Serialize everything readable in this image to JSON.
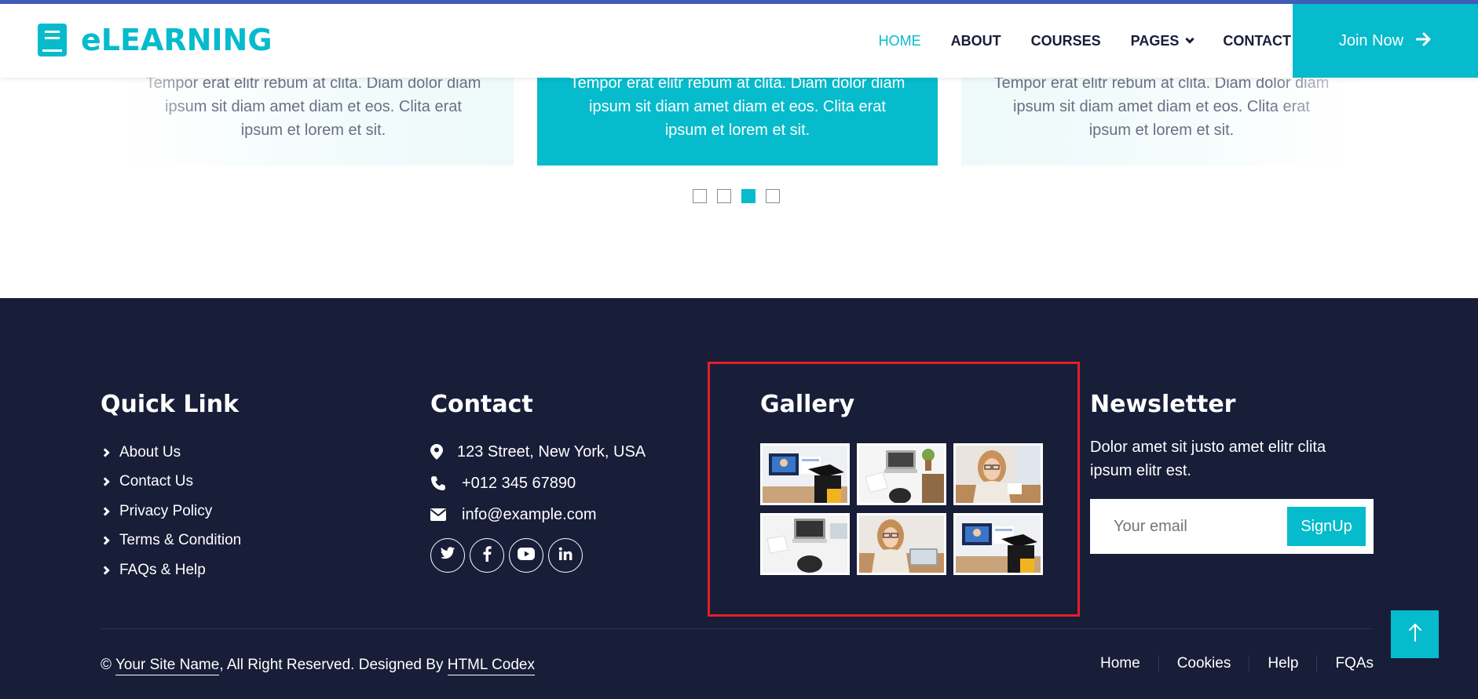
{
  "navbar": {
    "brand": "eLEARNING",
    "items": [
      {
        "label": "HOME",
        "active": true
      },
      {
        "label": "ABOUT",
        "active": false
      },
      {
        "label": "COURSES",
        "active": false
      },
      {
        "label": "PAGES",
        "active": false
      },
      {
        "label": "CONTACT",
        "active": false
      }
    ],
    "cta": "Join Now"
  },
  "testimonials": [
    {
      "text": "Tempor erat elitr rebum at clita. Diam dolor diam ipsum sit diam amet diam et eos. Clita erat ipsum et lorem et sit."
    },
    {
      "text": "Tempor erat elitr rebum at clita. Diam dolor diam ipsum sit diam amet diam et eos. Clita erat ipsum et lorem et sit."
    },
    {
      "text": "Tempor erat elitr rebum at clita. Diam dolor diam ipsum sit diam amet diam et eos. Clita erat ipsum et lorem et sit."
    }
  ],
  "carousel": {
    "count": 4,
    "active_index": 2
  },
  "footer": {
    "quick_link": {
      "title": "Quick Link",
      "links": [
        "About Us",
        "Contact Us",
        "Privacy Policy",
        "Terms & Condition",
        "FAQs & Help"
      ]
    },
    "contact": {
      "title": "Contact",
      "address": "123 Street, New York, USA",
      "phone": "+012 345 67890",
      "email": "info@example.com"
    },
    "gallery": {
      "title": "Gallery"
    },
    "newsletter": {
      "title": "Newsletter",
      "text": "Dolor amet sit justo amet elitr clita ipsum elitr est.",
      "placeholder": "Your email",
      "button": "SignUp"
    },
    "copyright": {
      "prefix": "©",
      "site": "Your Site Name",
      "middle": ", All Right Reserved. Designed By",
      "designer": "HTML Codex"
    },
    "menu": [
      "Home",
      "Cookies",
      "Help",
      "FQAs"
    ]
  },
  "colors": {
    "primary": "#06bbcc",
    "dark": "#181d38",
    "highlight": "#e41e2a"
  }
}
